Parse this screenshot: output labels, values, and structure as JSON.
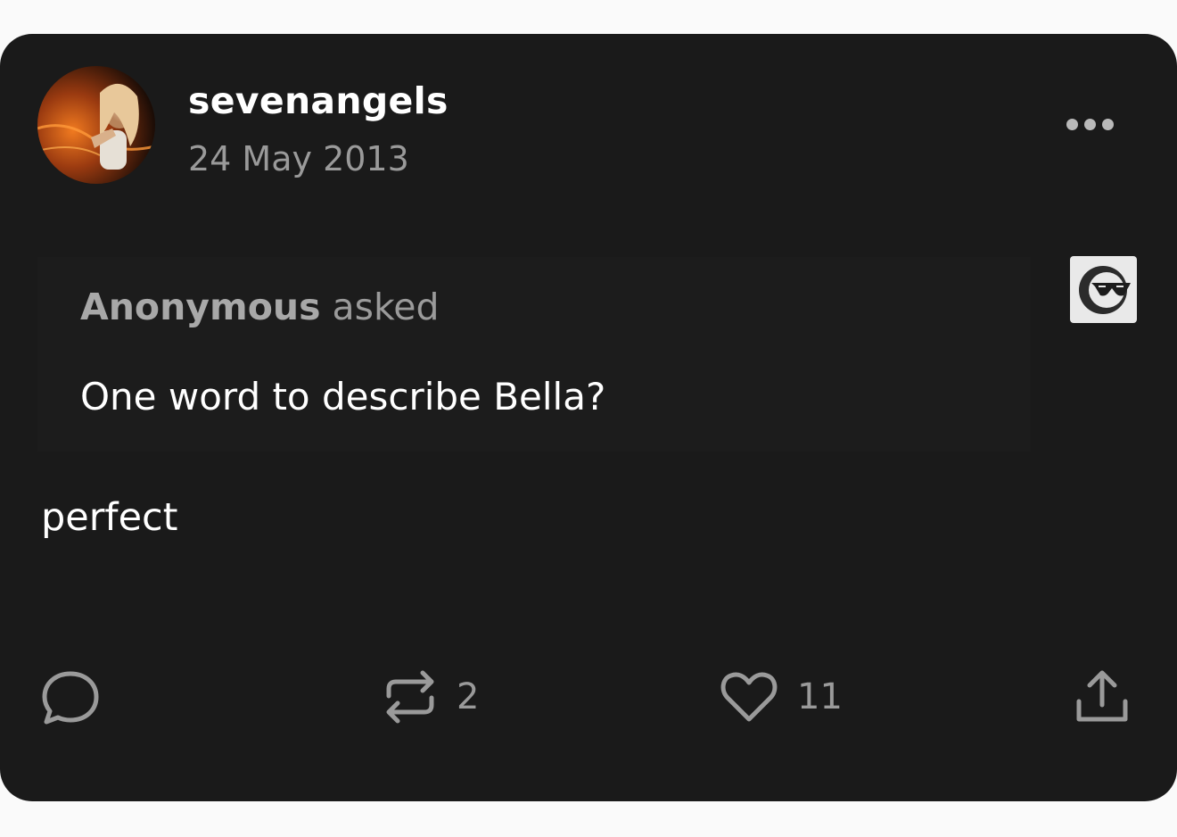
{
  "post": {
    "username": "sevenangels",
    "date": "24 May 2013",
    "asker": "Anonymous",
    "asked_word": "asked",
    "question": "One word to describe Bella?",
    "answer": "perfect"
  },
  "actions": {
    "reblogs": "2",
    "likes": "11"
  },
  "icons": {
    "more": "more-options-icon",
    "badge": "anonymous-sunglasses-icon",
    "reply": "comment-bubble-icon",
    "reblog": "reblog-icon",
    "like": "heart-icon",
    "share": "share-upload-icon"
  },
  "colors": {
    "card_bg": "#1a1a1a",
    "text_primary": "#ffffff",
    "text_secondary": "#9a9a9a",
    "icon_gray": "#9a9a9a"
  }
}
